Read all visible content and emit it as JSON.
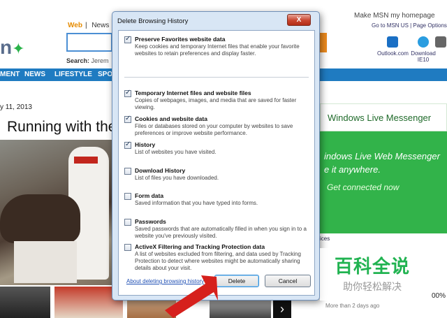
{
  "msn": {
    "search_tabs": [
      "Web",
      "News",
      "I"
    ],
    "search_hint_label": "Search:",
    "search_hint_value": "Jerem",
    "top_links": {
      "homepage": "Make MSN my homepage",
      "go_to": "Go to MSN US | Page Options"
    },
    "tiles": [
      {
        "label": "Outlook.com",
        "icon": "outlook-icon"
      },
      {
        "label": "Download IE10",
        "icon": "ie-icon"
      }
    ],
    "nav": [
      "MENT",
      "NEWS",
      "LIFESTYLE",
      "SPO"
    ],
    "date": "y 11, 2013",
    "headline": "Running with the",
    "ad": {
      "brand": "Windows Live Messenger",
      "hero_line1": "indows Live Web Messenger",
      "hero_line2": "e it anywhere.",
      "cta": "Get connected now",
      "choices": "ices",
      "more": "More than 2 days ago",
      "pct": "00%"
    },
    "next_arrow": "›"
  },
  "dialog": {
    "title": "Delete Browsing History",
    "close_label": "X",
    "options": [
      {
        "name": "Preserve Favorites website data",
        "checked": true,
        "desc": "Keep cookies and temporary Internet files that enable your favorite websites to retain preferences and display faster."
      },
      {
        "name": "Temporary Internet files and website files",
        "checked": true,
        "desc": "Copies of webpages, images, and media that are saved for faster viewing."
      },
      {
        "name": "Cookies and website data",
        "checked": true,
        "desc": "Files or databases stored on your computer by websites to save preferences or improve website performance."
      },
      {
        "name": "History",
        "checked": true,
        "desc": "List of websites you have visited."
      },
      {
        "name": "Download History",
        "checked": false,
        "desc": "List of files you have downloaded."
      },
      {
        "name": "Form data",
        "checked": false,
        "desc": "Saved information that you have typed into forms."
      },
      {
        "name": "Passwords",
        "checked": false,
        "desc": "Saved passwords that are automatically filled in when you sign in to a website you've previously visited."
      },
      {
        "name": "ActiveX Filtering and Tracking Protection data",
        "checked": false,
        "desc": "A list of websites excluded from filtering, and data used by Tracking Protection to detect where websites might be automatically sharing details about your visit."
      }
    ],
    "about_link": "About deleting browsing history",
    "delete_label": "Delete",
    "cancel_label": "Cancel",
    "tick_glyph": "✓"
  },
  "watermark": {
    "line1": "百科全说",
    "line2": "助你轻松解决"
  }
}
